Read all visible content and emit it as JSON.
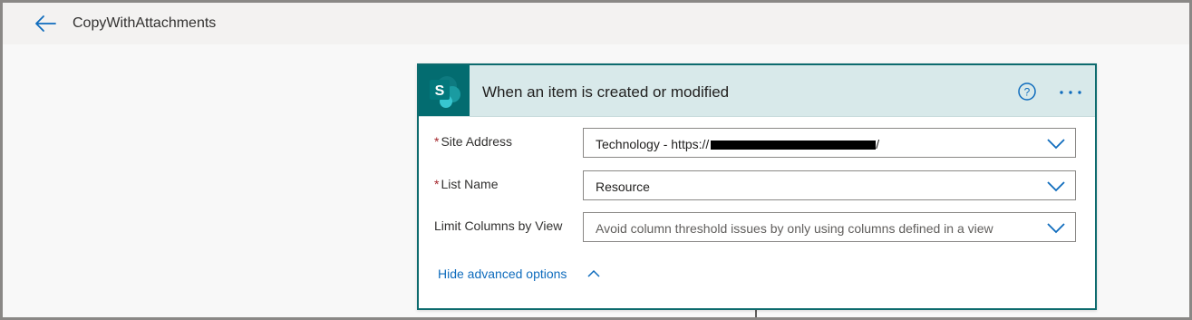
{
  "header": {
    "flow_title": "CopyWithAttachments"
  },
  "trigger_card": {
    "icon_letter": "S",
    "title": "When an item is created or modified",
    "accent_color": "#036c70",
    "header_bg": "#d8e9ea",
    "fields": [
      {
        "label": "Site Address",
        "required": "*",
        "value": "Technology - https://"
      },
      {
        "label": "List Name",
        "required": "*",
        "value": "Resource"
      },
      {
        "label": "Limit Columns by View",
        "required": "",
        "value": "Avoid column threshold issues by only using columns defined in a view"
      }
    ],
    "advanced_toggle_label": "Hide advanced options"
  },
  "icons": {
    "back": "arrow-left-icon",
    "help": "question-circle-icon",
    "more": "ellipsis-icon",
    "dropdown": "chevron-down-icon",
    "collapse": "chevron-up-icon"
  }
}
